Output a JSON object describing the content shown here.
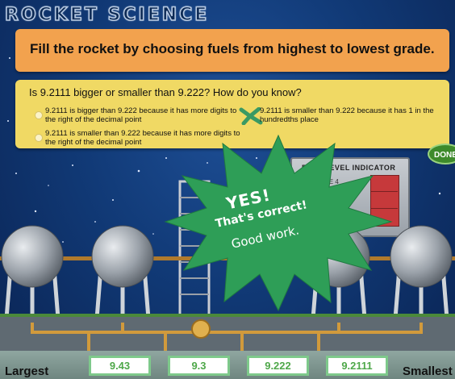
{
  "game": {
    "title": "ROCKET SCIENCE",
    "instruction": "Fill the rocket by choosing fuels from highest to lowest grade.",
    "question": "Is 9.2111 bigger or smaller than 9.222? How do you know?",
    "options": [
      "9.2111 is bigger than 9.222 because it has more digits to the right of the decimal point",
      "9.2111 is smaller than 9.222 because it has more digits to the right of the decimal point",
      "9.2111 is smaller than 9.222 because it has 1 in the hundredths place"
    ],
    "selected_option_index": 2,
    "done_label": "DONE",
    "fuel_panel": {
      "title": "FUEL LEVEL INDICATOR",
      "fuel_type": "FUEL TYPE 4"
    },
    "feedback": {
      "line1": "YES!",
      "line2": "That's correct!",
      "line3": "Good work."
    },
    "order_labels": {
      "largest": "Largest",
      "smallest": "Smallest"
    },
    "slots": [
      "9.43",
      "9.3",
      "9.222",
      "9.2111"
    ],
    "colors": {
      "instruction_bg": "#f2a24e",
      "quiz_bg": "#f0d964",
      "burst": "#2e9e57",
      "slot_border": "#7ec98b",
      "slot_text": "#4fa84a"
    }
  }
}
